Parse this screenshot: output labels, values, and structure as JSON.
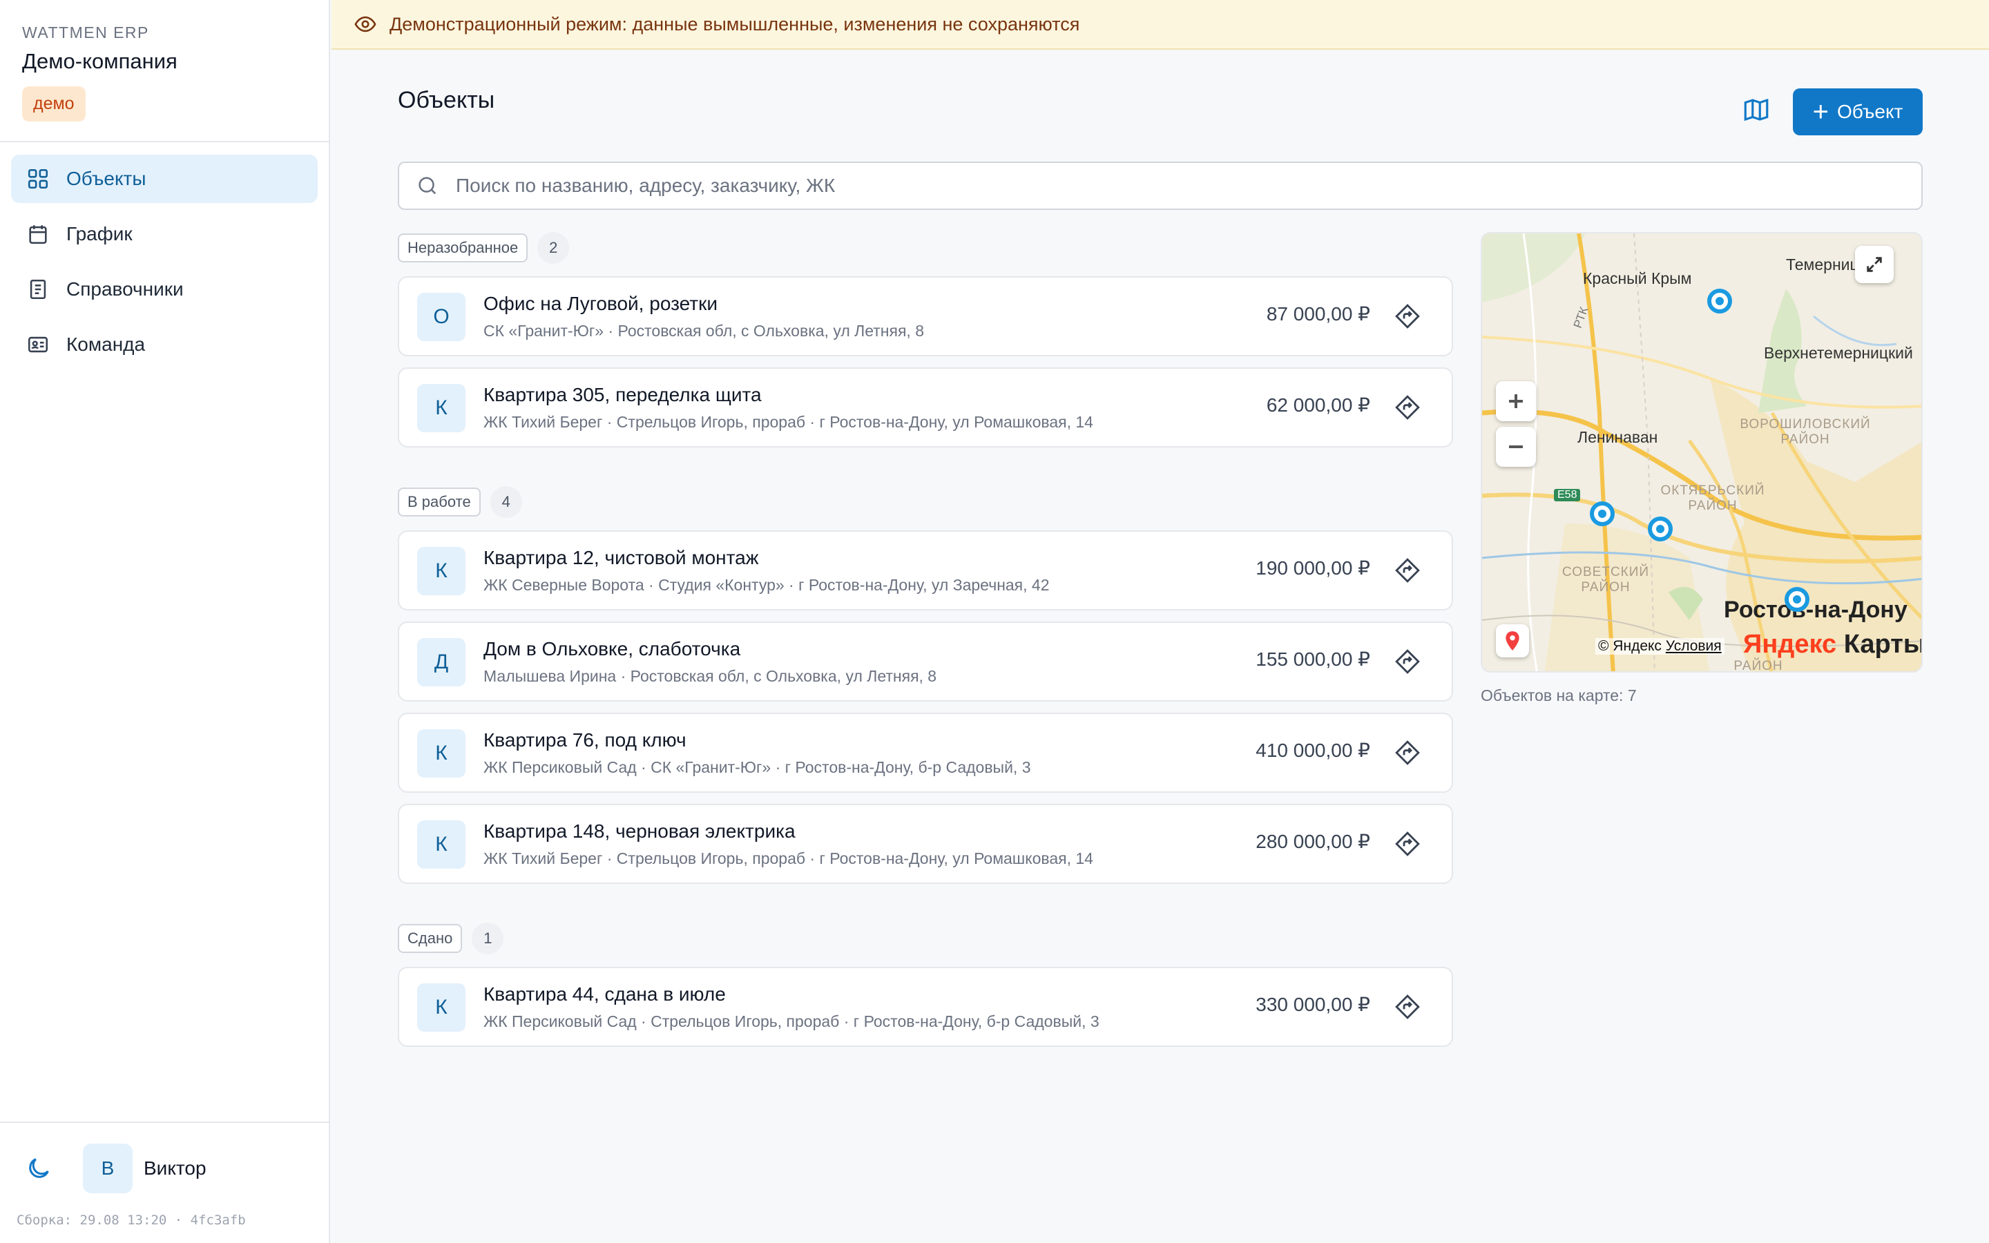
{
  "brand": {
    "sub": "WATTMEN ERP",
    "name": "Демо-компания",
    "badge": "демо"
  },
  "nav": [
    {
      "label": "Объекты",
      "icon": "grid-icon",
      "active": true
    },
    {
      "label": "График",
      "icon": "calendar-icon"
    },
    {
      "label": "Справочники",
      "icon": "book-icon"
    },
    {
      "label": "Команда",
      "icon": "id-card-icon"
    }
  ],
  "user": {
    "initial": "В",
    "name": "Виктор"
  },
  "build": "Сборка: 29.08 13:20 · 4fc3afb",
  "banner": "Демонстрационный режим: данные вымышленные, изменения не сохраняются",
  "page": {
    "title": "Объекты",
    "add_label": "Объект"
  },
  "search": {
    "placeholder": "Поиск по названию, адресу, заказчику, ЖК",
    "value": ""
  },
  "groups": [
    {
      "tag": "Неразобранное",
      "count": "2",
      "items": [
        {
          "initial": "О",
          "title": "Офис на Луговой, розетки",
          "subtitle": "СК «Гранит-Юг» · Ростовская обл, с Ольховка, ул Летняя, 8",
          "price": "87 000,00 ₽"
        },
        {
          "initial": "К",
          "title": "Квартира 305, переделка щита",
          "subtitle": "ЖК Тихий Берег · Стрельцов Игорь, прораб · г Ростов-на-Дону, ул Ромашковая, 14",
          "price": "62 000,00 ₽"
        }
      ]
    },
    {
      "tag": "В работе",
      "count": "4",
      "items": [
        {
          "initial": "К",
          "title": "Квартира 12, чистовой монтаж",
          "subtitle": "ЖК Северные Ворота · Студия «Контур» · г Ростов-на-Дону, ул Заречная, 42",
          "price": "190 000,00 ₽"
        },
        {
          "initial": "Д",
          "title": "Дом в Ольховке, слаботочка",
          "subtitle": "Малышева Ирина · Ростовская обл, с Ольховка, ул Летняя, 8",
          "price": "155 000,00 ₽"
        },
        {
          "initial": "К",
          "title": "Квартира 76, под ключ",
          "subtitle": "ЖК Персиковый Сад · СК «Гранит-Юг» · г Ростов-на-Дону, б-р Садовый, 3",
          "price": "410 000,00 ₽"
        },
        {
          "initial": "К",
          "title": "Квартира 148, черновая электрика",
          "subtitle": "ЖК Тихий Берег · Стрельцов Игорь, прораб · г Ростов-на-Дону, ул Ромашковая, 14",
          "price": "280 000,00 ₽"
        }
      ]
    },
    {
      "tag": "Сдано",
      "count": "1",
      "items": [
        {
          "initial": "К",
          "title": "Квартира 44, сдана в июле",
          "subtitle": "ЖК Персиковый Сад · Стрельцов Игорь, прораб · г Ростов-на-Дону, б-р Садовый, 3",
          "price": "330 000,00 ₽"
        }
      ]
    }
  ],
  "map": {
    "labels": {
      "krasny_krym": "Красный Крым",
      "temernitsky": "Темерницкий",
      "verkhnetem": "Верхнетемерницкий",
      "leninavan": "Ленинаван",
      "rostov": "Ростов-на-Дону",
      "voroshil": "ВОРОШИЛОВСКИЙ РАЙОН",
      "oktyabr": "ОКТЯБРЬСКИЙ РАЙОН",
      "sovetsky": "СОВЕТСКИЙ РАЙОН",
      "rayon": "РАЙОН",
      "road_e58": "E58",
      "road_rtk": "РТК"
    },
    "copyright": "© Яндекс",
    "terms": "Условия",
    "logo_ya": "Яндекс",
    "logo_maps": "Карты",
    "count_text": "Объектов на карте: 7"
  },
  "colors": {
    "accent": "#1178c8",
    "marker": "#1a9ae0",
    "banner_bg": "#fdf6df"
  }
}
